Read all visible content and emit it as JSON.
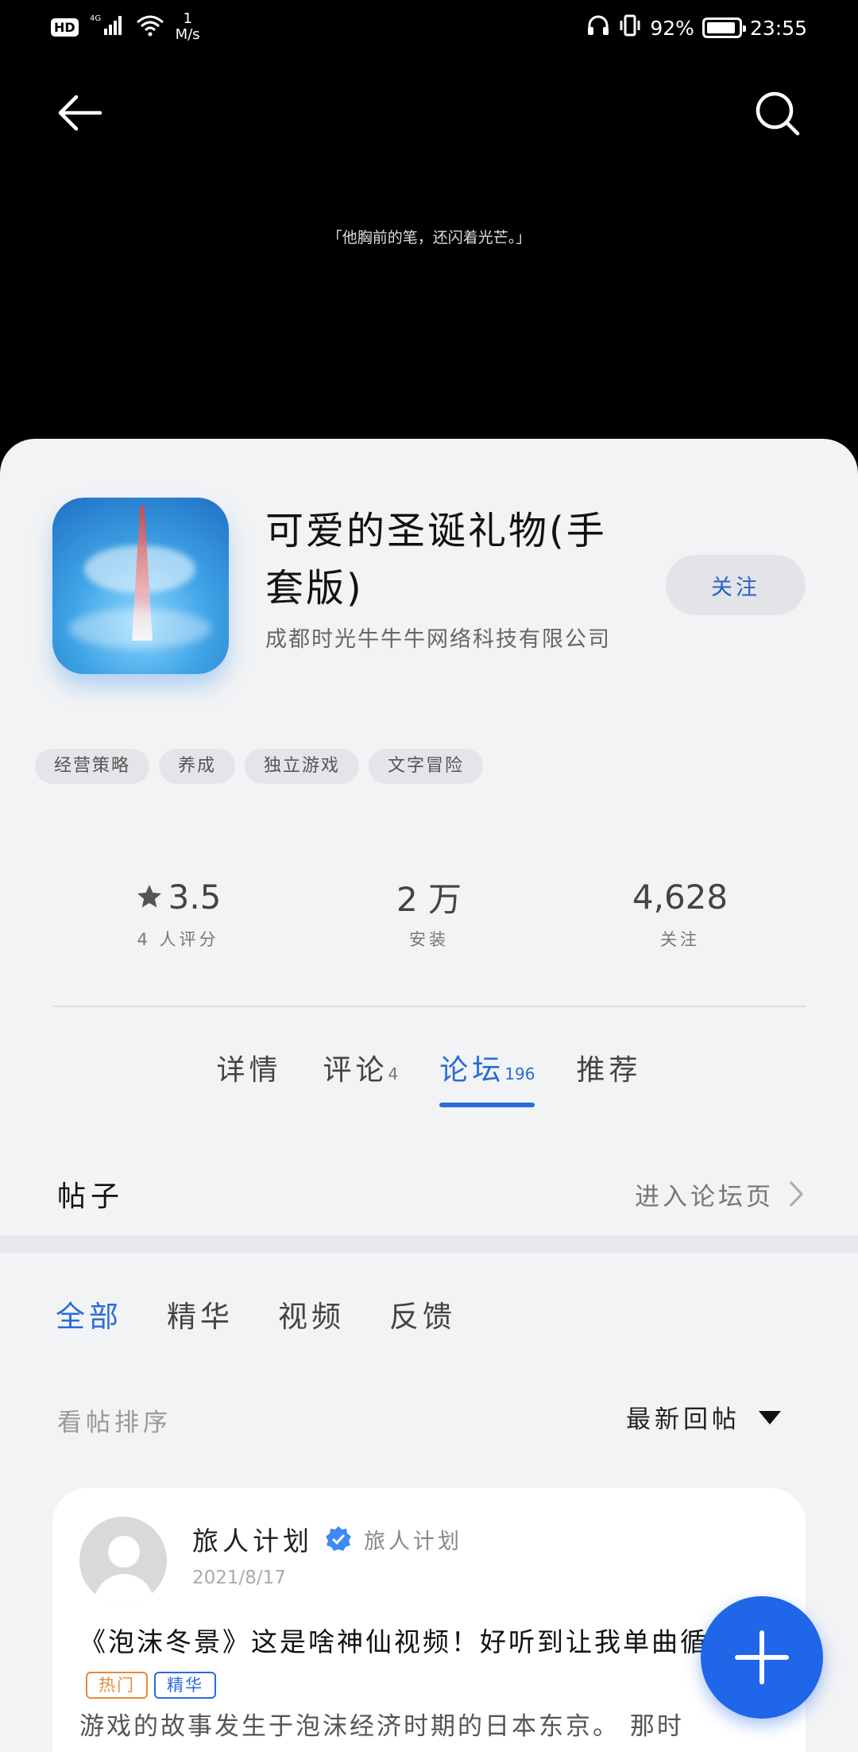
{
  "status_bar": {
    "hd": "HD",
    "network": "4G",
    "speed_value": "1",
    "speed_unit": "M/s",
    "battery_percent": "92%",
    "battery_level": 0.92,
    "time": "23:55"
  },
  "banner": {
    "quote": "「他胸前的笔，还闪着光芒。」"
  },
  "app": {
    "title": "可爱的圣诞礼物(手套版)",
    "developer": "成都时光牛牛牛网络科技有限公司",
    "follow_label": "关注",
    "tags": [
      "经营策略",
      "养成",
      "独立游戏",
      "文字冒险"
    ]
  },
  "stats": {
    "rating_value": "3.5",
    "rating_label": "4 人评分",
    "installs_value": "2 万",
    "installs_label": "安装",
    "followers_value": "4,628",
    "followers_label": "关注"
  },
  "tabs": [
    {
      "label": "详情",
      "count": ""
    },
    {
      "label": "评论",
      "count": "4"
    },
    {
      "label": "论坛",
      "count": "196"
    },
    {
      "label": "推荐",
      "count": ""
    }
  ],
  "posts_section": {
    "title": "帖子",
    "forum_link": "进入论坛页"
  },
  "filters": [
    "全部",
    "精华",
    "视频",
    "反馈"
  ],
  "sort": {
    "label": "看帖排序",
    "selected": "最新回帖"
  },
  "post": {
    "author": "旅人计划",
    "author_tag": "旅人计划",
    "date": "2021/8/17",
    "title": "《泡沫冬景》这是啥神仙视频！好听到让我单曲循环",
    "badge_hot": "热门",
    "badge_best": "精华",
    "excerpt": "游戏的故事发生于泡沫经济时期的日本东京。 那时"
  },
  "colors": {
    "accent": "#2a6bd8",
    "fab": "#1f66e8",
    "hot": "#e68a3a"
  }
}
